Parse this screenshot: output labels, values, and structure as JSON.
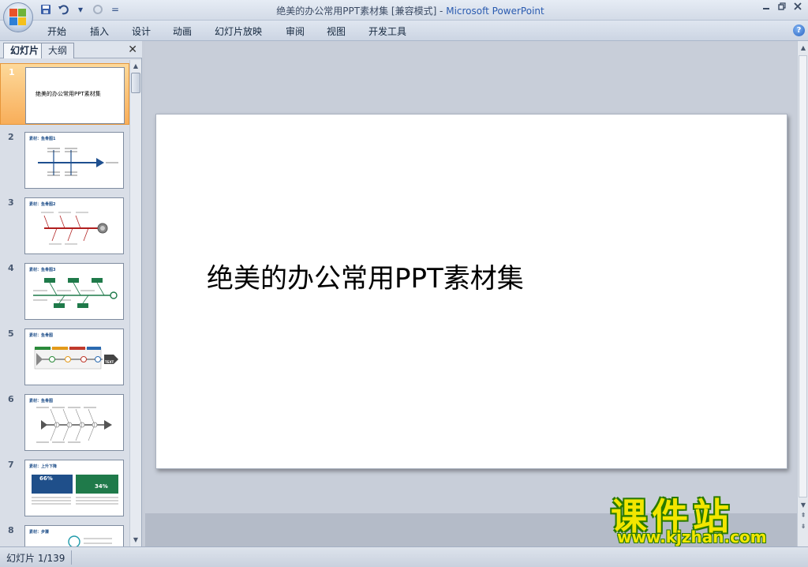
{
  "window": {
    "title_doc": "绝美的办公常用PPT素材集 [兼容模式] - ",
    "title_app": "Microsoft PowerPoint"
  },
  "quick_access": {
    "icons": [
      "save-icon",
      "undo-icon",
      "redo-icon",
      "customize-icon"
    ],
    "undo_arrow": "▾",
    "customize_label": "="
  },
  "ribbon": {
    "tabs": [
      "开始",
      "插入",
      "设计",
      "动画",
      "幻灯片放映",
      "审阅",
      "视图",
      "开发工具"
    ],
    "help_label": "?"
  },
  "panel": {
    "tab_slides": "幻灯片",
    "tab_outline": "大纲",
    "close_label": "✕",
    "thumbnails": [
      {
        "num": "1",
        "caption": "绝美的办公常用PPT素材集",
        "selected": true
      },
      {
        "num": "2",
        "caption": "素材：鱼骨图1"
      },
      {
        "num": "3",
        "caption": "素材：鱼骨图2"
      },
      {
        "num": "4",
        "caption": "素材：鱼骨图3"
      },
      {
        "num": "5",
        "caption": "素材：鱼骨图"
      },
      {
        "num": "6",
        "caption": "素材：鱼骨图"
      },
      {
        "num": "7",
        "caption": "素材：上升下降"
      },
      {
        "num": "8",
        "caption": "素材：步骤"
      }
    ],
    "thumb7_pct_left": "66%",
    "thumb7_pct_right": "34%",
    "thumb5_tag": "TEXT"
  },
  "slide": {
    "title": "绝美的办公常用PPT素材集"
  },
  "watermark": {
    "main": "课件站",
    "url": "www.kjzhan.com"
  },
  "status": {
    "slide_counter": "幻灯片 1/139"
  },
  "colors": {
    "accent_selected": "#f8ae5a",
    "fishbone_blue": "#1e4f8f",
    "fishbone_red": "#b01e1e",
    "fishbone_green": "#1f7a4a"
  }
}
